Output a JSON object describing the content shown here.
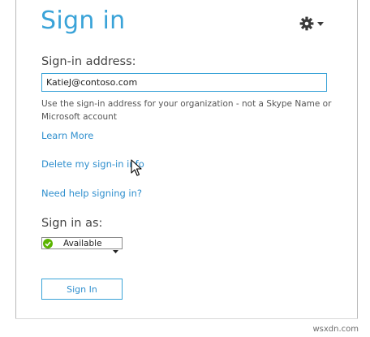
{
  "title": "Sign in",
  "gear_icon": "gear-icon",
  "address": {
    "label": "Sign-in address:",
    "value": "KatieJ@contoso.com"
  },
  "help_text": "Use the sign-in address for your organization - not a Skype Name or Microsoft account",
  "links": {
    "learn_more": "Learn More",
    "delete_info": "Delete my sign-in info",
    "need_help": "Need help signing in?"
  },
  "sign_in_as": {
    "label": "Sign in as:",
    "status": "Available",
    "status_color": "#5bb400"
  },
  "sign_in_button": "Sign In",
  "watermark": "wsxdn.com",
  "colors": {
    "accent": "#3aa3d8",
    "link": "#2f8fce"
  }
}
